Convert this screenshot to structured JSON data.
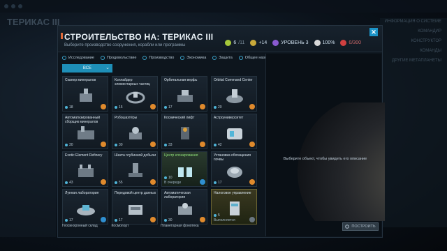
{
  "background": {
    "title": "ТЕРИКАС III",
    "right_labels": [
      "ИНФОРМАЦИЯ О СИСТЕМЕ",
      "КОМАНДИР",
      "КОНСТРУКТОР",
      "КОМАНДЫ",
      "ДРУГИЕ МЕТАПЛАНЕТЫ"
    ]
  },
  "modal": {
    "title": "СТРОИТЕЛЬСТВО НА: ТЕРИКАС III",
    "subtitle": "Выберите производство сооружения, корабли или программы",
    "stats": {
      "resource": "6",
      "resource_max": "/11",
      "income": "+14",
      "level": "УРОВЕНЬ 3",
      "approval": "100%",
      "influence": "0/300"
    },
    "close_label": "✕",
    "filters": [
      "Исследование",
      "Продовольствие",
      "Производство",
      "Экономика",
      "Защита",
      "Общее назначение"
    ],
    "dropdown": {
      "value": "ВСЕ"
    },
    "cards": [
      {
        "name": "Сканер минералов",
        "cost": "18",
        "badge": "orange"
      },
      {
        "name": "Коллайдер элементарных частиц",
        "cost": "15",
        "badge": "orange"
      },
      {
        "name": "Орбитальная верфь",
        "cost": "17",
        "badge": "orange"
      },
      {
        "name": "Orbital Command Center",
        "cost": "20",
        "badge": "orange"
      },
      {
        "name": "Автоматизированный сборщик минералов",
        "cost": "30",
        "badge": "orange"
      },
      {
        "name": "Робошахтёры",
        "cost": "30",
        "badge": "orange"
      },
      {
        "name": "Космический лифт",
        "cost": "33",
        "badge": "orange"
      },
      {
        "name": "Астроуниверситет",
        "cost": "42",
        "badge": "orange"
      },
      {
        "name": "Exotic Element Refinery",
        "cost": "43",
        "badge": "orange"
      },
      {
        "name": "Шахта глубинной добычи",
        "cost": "55",
        "badge": "orange"
      },
      {
        "name": "Центр клонирования",
        "cost": "10",
        "sub": "В очереди",
        "badge": "blue",
        "state": "active"
      },
      {
        "name": "Установка обогащения почвы",
        "cost": "17",
        "badge": "orange"
      },
      {
        "name": "Лунная лаборатория",
        "cost": "17",
        "badge": "blue"
      },
      {
        "name": "Передовой центр данных",
        "cost": "17",
        "badge": "orange"
      },
      {
        "name": "Автоматическая лаборатория",
        "cost": "30",
        "badge": "orange"
      },
      {
        "name": "Налоговое управление",
        "cost": "5",
        "sub": "Выполняется",
        "badge": "gray",
        "state": "selected"
      }
    ],
    "bottom_row": [
      "Геосинхронный склад",
      "Космопорт",
      "Планетарная фонотека",
      ""
    ],
    "right_panel": {
      "hint": "Выберите объект, чтобы увидеть его описание",
      "build_label": "ПОСТРОИТЬ"
    }
  },
  "colors": {
    "accent": "#1e8fb8",
    "title_mark": "#e06a3a",
    "active_text": "#8fe07a",
    "badge_orange": "#e08a2c",
    "badge_blue": "#2f8fd0"
  }
}
